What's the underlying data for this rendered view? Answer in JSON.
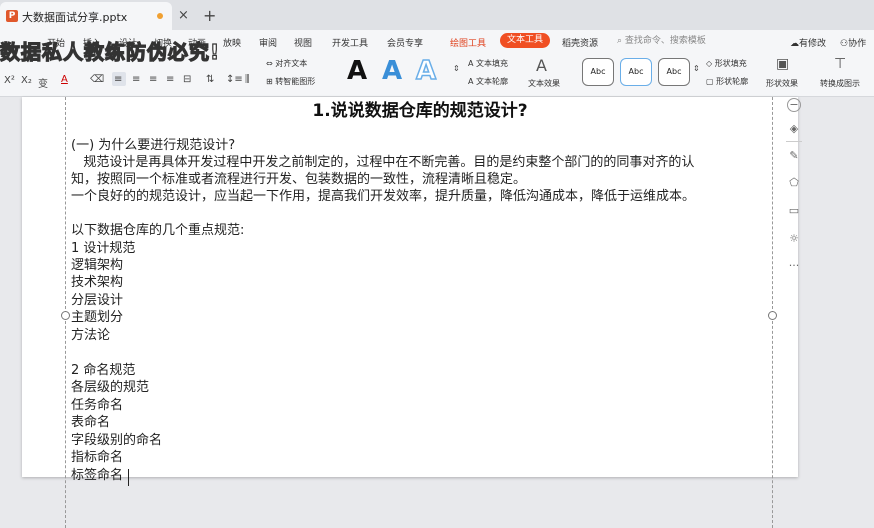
{
  "window": {
    "tab_title": "大数据面试分享.pptx",
    "ppt_logo": "P",
    "close_glyph": "×",
    "add_glyph": "+"
  },
  "watermark": "数据私人教练防伪必究!",
  "ribbon": {
    "menus": [
      "开始",
      "插入",
      "设计",
      "切换",
      "动画",
      "放映",
      "审阅",
      "视图",
      "开发工具",
      "会员专享"
    ],
    "drawing_tools": "绘图工具",
    "text_tools": "文本工具",
    "resources": "稻壳资源",
    "search_placeholder": "查找命令、搜索模板",
    "unsaved": "有修改",
    "collab": "协作",
    "align_text": "对齐文本",
    "smart_shape": "转智能图形",
    "text_fill": "文本填充",
    "text_outline": "文本轮廓",
    "text_effect": "文本效果",
    "shape_fill": "形状填充",
    "shape_outline": "形状轮廓",
    "shape_effect": "形状效果",
    "convert_chart": "转换成图示",
    "abc": "Abc",
    "big_a": "A",
    "superscript": "X²",
    "subscript": "X₂",
    "pinyin": "变",
    "font_color": "A"
  },
  "slide": {
    "title": "1.说说数据仓库的规范设计?",
    "lines": [
      "(一) 为什么要进行规范设计?",
      "   规范设计是再具体开发过程中开发之前制定的，过程中在不断完善。目的是约束整个部门的的同事对齐的认",
      "知，按照同一个标准或者流程进行开发、包装数据的一致性，流程清晰且稳定。",
      "一个良好的的规范设计，应当起一下作用，提高我们开发效率，提升质量，降低沟通成本，降低于运维成本。",
      "",
      "以下数据仓库的几个重点规范:",
      "1 设计规范",
      "逻辑架构",
      "技术架构",
      "分层设计",
      "主题划分",
      "方法论",
      "",
      "2 命名规范",
      "各层级的规范",
      "任务命名",
      "表命名",
      "字段级别的命名",
      "指标命名",
      "标签命名"
    ]
  },
  "right_panel": {
    "collapse": "−",
    "more": "···"
  },
  "colors": {
    "accent": "#f04f23",
    "text_a_blue": "#3a8fd8",
    "text_a_outline": "#6aaee8"
  }
}
